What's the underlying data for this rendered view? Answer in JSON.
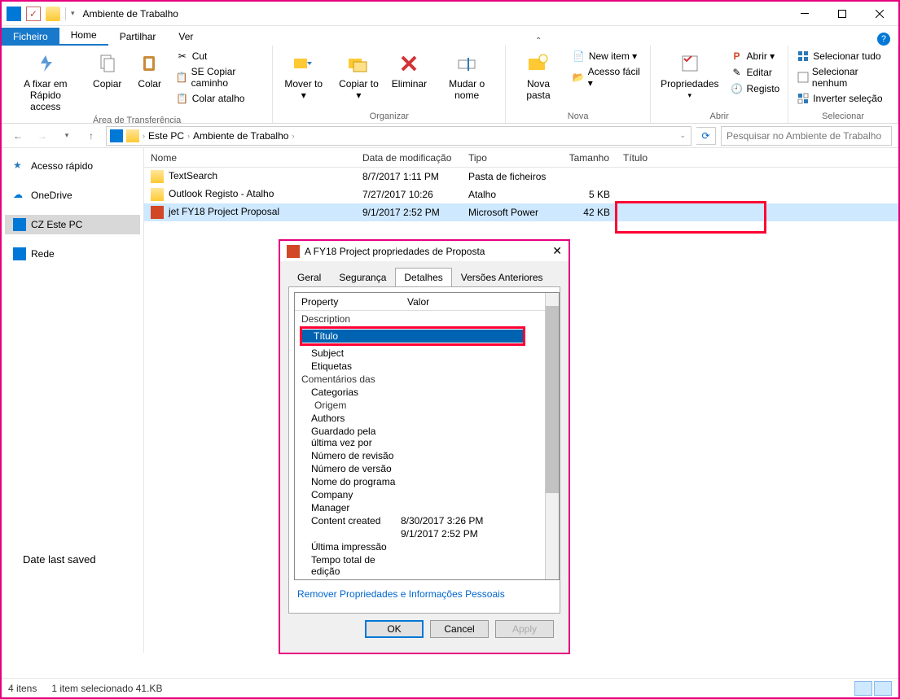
{
  "window": {
    "title": "Ambiente de Trabalho"
  },
  "tabs": {
    "file": "Ficheiro",
    "home": "Home",
    "share": "Partilhar",
    "view": "Ver"
  },
  "ribbon": {
    "clipboard": {
      "pin": "A fixar em Rápido",
      "pin2": "access",
      "copy": "Copiar",
      "paste": "Colar",
      "cut": "Cut",
      "copy_path": "SE Copiar caminho",
      "paste_shortcut": "Colar atalho",
      "label": "Área de Transferência"
    },
    "organize": {
      "move": "Mover to ▾",
      "copy": "Copiar to ▾",
      "delete": "Eliminar",
      "rename": "Mudar o nome",
      "label": "Organizar"
    },
    "new": {
      "folder": "Nova pasta",
      "item": "New item ▾",
      "easy": "Acesso fácil ▾",
      "label": "Nova"
    },
    "open": {
      "properties": "Propriedades",
      "open": "Abrir ▾",
      "edit": "Editar",
      "history": "Registo",
      "label": "Abrir"
    },
    "select": {
      "all": "Selecionar tudo",
      "none": "Selecionar nenhum",
      "invert": "Inverter seleção",
      "label": "Selecionar"
    }
  },
  "address": {
    "crumbs": [
      "Este PC",
      "Ambiente de Trabalho"
    ],
    "search_placeholder": "Pesquisar no Ambiente de Trabalho"
  },
  "nav": {
    "quick": "Acesso rápido",
    "onedrive": "OneDrive",
    "thispc": "CZ Este PC",
    "network": "Rede"
  },
  "columns": {
    "name": "Nome",
    "date": "Data de modificação",
    "type": "Tipo",
    "size": "Tamanho",
    "title": "Título"
  },
  "rows": [
    {
      "name": "TextSearch",
      "date": "8/7/2017 1:11 PM",
      "type": "Pasta de ficheiros",
      "size": "",
      "icon": "fld"
    },
    {
      "name": "Outlook Registo - Atalho",
      "date": "7/27/2017  10:26",
      "type": "Atalho",
      "size": "5 KB",
      "icon": "lnk"
    },
    {
      "name": "jet FY18 Project Proposal",
      "date": "9/1/2017 2:52 PM",
      "type": "Microsoft Power",
      "size": "42 KB",
      "icon": "ppt"
    }
  ],
  "status": {
    "items": "4 itens",
    "sel": "1 item selecionado 41.KB"
  },
  "annotation": "Date last saved",
  "dialog": {
    "title": "A FY18 Project propriedades de Proposta",
    "tabs": {
      "general": "Geral",
      "security": "Segurança",
      "details": "Detalhes",
      "previous": "Versões Anteriores"
    },
    "header": {
      "property": "Property",
      "value": "Valor"
    },
    "rows": [
      {
        "p": "Description",
        "h": true
      },
      {
        "p": "Título",
        "sel": true
      },
      {
        "p": "Subject"
      },
      {
        "p": "Etiquetas"
      },
      {
        "p": "Comentários das",
        "h": true
      },
      {
        "p": "Categorias"
      },
      {
        "p": "Origem",
        "h": true,
        "indent": true
      },
      {
        "p": "Authors"
      },
      {
        "p": "Guardado pela última vez por"
      },
      {
        "p": "Número de revisão"
      },
      {
        "p": "Número de versão"
      },
      {
        "p": "Nome do programa"
      },
      {
        "p": "Company"
      },
      {
        "p": "Manager"
      },
      {
        "p": "Content created",
        "v": "8/30/2017 3:26 PM"
      },
      {
        "p": "",
        "v": "9/1/2017 2:52 PM"
      },
      {
        "p": "Última impressão"
      },
      {
        "p": "Tempo total de edição"
      }
    ],
    "link": "Remover Propriedades e Informações Pessoais",
    "buttons": {
      "ok": "OK",
      "cancel": "Cancel",
      "apply": "Apply"
    }
  }
}
